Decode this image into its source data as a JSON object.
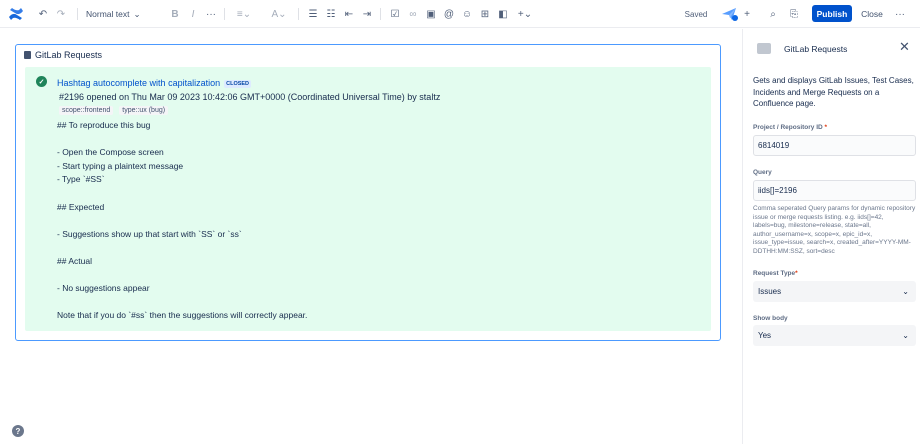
{
  "toolbar": {
    "text_style": "Normal text",
    "saved": "Saved",
    "publish": "Publish",
    "close": "Close",
    "icons": [
      "confluence-logo",
      "undo-icon",
      "redo-icon",
      "bold-icon",
      "italic-icon",
      "more-formatting-icon",
      "align-icon",
      "text-color-icon",
      "bullet-list-icon",
      "numbered-list-icon",
      "outdent-icon",
      "indent-icon",
      "task-icon",
      "link-icon",
      "image-icon",
      "mention-icon",
      "emoji-icon",
      "table-icon",
      "layout-icon",
      "insert-icon",
      "search-icon",
      "copy-link-icon",
      "more-icon"
    ],
    "colors": {
      "publish_bg": "#0052cc",
      "accent": "#4c9aff"
    }
  },
  "macro": {
    "title": "GitLab Requests",
    "issue": {
      "title": "Hashtag autocomplete with capitalization",
      "status": "CLOSED",
      "meta": "#2196 opened on Thu Mar 09 2023 10:42:06 GMT+0000 (Coordinated Universal Time) by staltz",
      "labels": [
        "scope::frontend",
        "type::ux (bug)"
      ],
      "body": [
        "## To reproduce this bug",
        "",
        "- Open the Compose screen",
        "- Start typing a plaintext message",
        "- Type `#SS`",
        "",
        "## Expected",
        "",
        "- Suggestions show up that start with `SS` or `ss`",
        "",
        "## Actual",
        "",
        "- No suggestions appear",
        "",
        "Note that if you do `#ss` then the suggestions will correctly appear."
      ]
    },
    "card_color": "#e3fcef"
  },
  "panel": {
    "title": "GitLab Requests",
    "description": "Gets and displays GitLab Issues, Test Cases, Incidents and Merge Requests on a Confluence page.",
    "project_label": "Project / Repository ID",
    "project_value": "6814019",
    "query_label": "Query",
    "query_value": "iids[]=2196",
    "query_help": "Comma seperated Query params for dynamic repository issue or merge requests listing. e.g. iids[]=42, labels=bug, milestone=release, state=all, author_username=x, scope=x, epic_id=x, issue_type=issue, search=x, created_after=YYYY-MM-DDTHH:MM:SSZ, sort=desc",
    "request_type_label": "Request Type",
    "request_type_value": "Issues",
    "show_body_label": "Show body",
    "show_body_value": "Yes"
  }
}
